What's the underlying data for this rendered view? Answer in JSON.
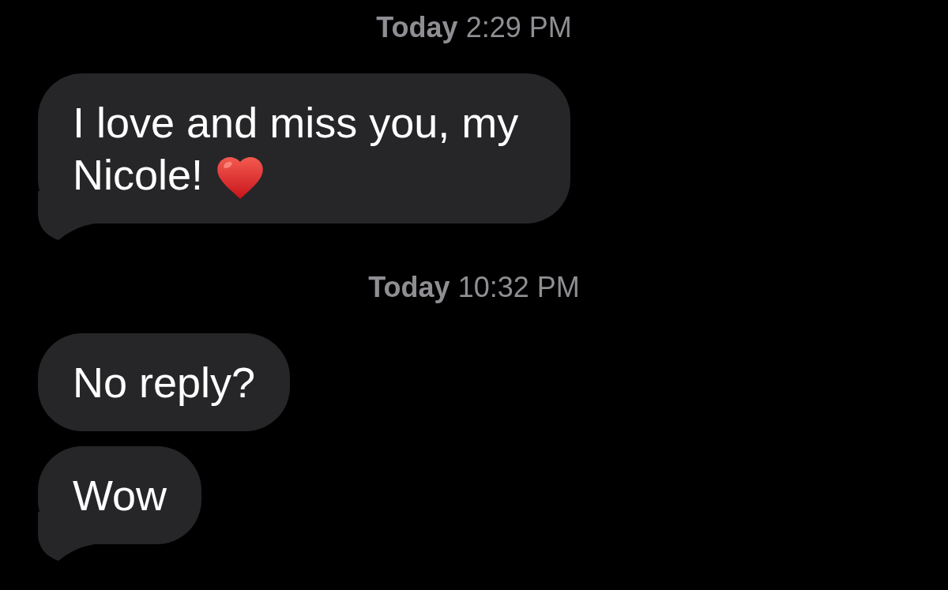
{
  "thread": [
    {
      "kind": "timestamp",
      "text": "**Today** 2:29 PM"
    },
    {
      "kind": "message",
      "text": "I love and miss you, my Nicole!",
      "emoji": true,
      "tail": true
    },
    {
      "kind": "timestamp",
      "text": "**Today** 10:32 PM"
    },
    {
      "kind": "message",
      "text": "No reply?",
      "emoji": false,
      "tail": false
    },
    {
      "kind": "message",
      "text": "Wow",
      "emoji": false,
      "tail": true
    }
  ]
}
